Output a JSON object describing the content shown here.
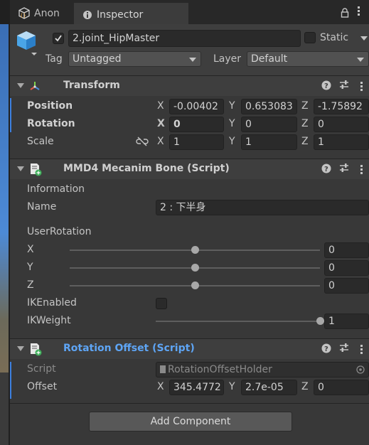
{
  "tabs": {
    "anon": "Anon",
    "inspector": "Inspector"
  },
  "object": {
    "name": "2.joint_HipMaster",
    "static_label": "Static",
    "tag_label": "Tag",
    "tag_value": "Untagged",
    "layer_label": "Layer",
    "layer_value": "Default",
    "active": true
  },
  "transform": {
    "title": "Transform",
    "position_label": "Position",
    "rotation_label": "Rotation",
    "scale_label": "Scale",
    "axis_x": "X",
    "axis_y": "Y",
    "axis_z": "Z",
    "position": [
      "-0.00402",
      "0.653083",
      "-1.75892"
    ],
    "rotation": [
      "0",
      "0",
      "0"
    ],
    "scale": [
      "1",
      "1",
      "1"
    ]
  },
  "mmd4": {
    "title": "MMD4 Mecanim Bone (Script)",
    "information_label": "Information",
    "name_label": "Name",
    "name_value": "2 : 下半身",
    "user_rotation_label": "UserRotation",
    "x_label": "X",
    "y_label": "Y",
    "z_label": "Z",
    "x_value": "0",
    "y_value": "0",
    "z_value": "0",
    "x_level": 0.5,
    "y_level": 0.5,
    "z_level": 0.5,
    "ik_enabled_label": "IKEnabled",
    "ik_weight_label": "IKWeight",
    "ik_weight_value": "1",
    "ik_weight_level": 1.0
  },
  "rotation_offset": {
    "title": "Rotation Offset (Script)",
    "script_label": "Script",
    "script_value": "RotationOffsetHolder",
    "offset_label": "Offset",
    "offset": [
      "345.4772",
      "2.7e-05",
      "0"
    ]
  },
  "add_component": "Add Component",
  "colors": {
    "accent": "#3d80df",
    "title_link": "#5ea5f5",
    "bg": "#383838"
  }
}
